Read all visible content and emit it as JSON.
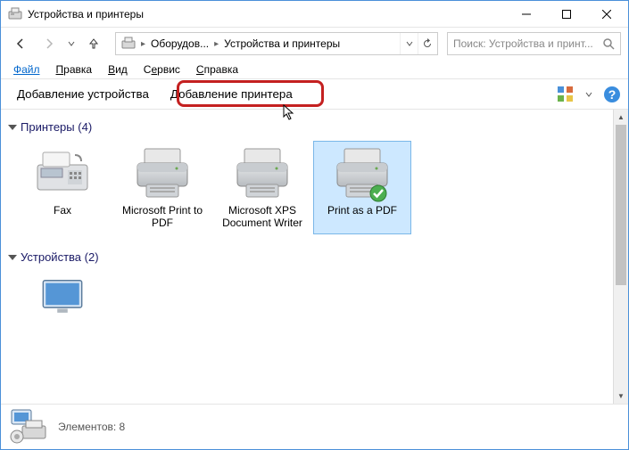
{
  "window": {
    "title": "Устройства и принтеры"
  },
  "breadcrumb": {
    "seg1": "Оборудов...",
    "seg2": "Устройства и принтеры"
  },
  "search": {
    "placeholder": "Поиск: Устройства и принт..."
  },
  "menu": {
    "file": "Файл",
    "edit": "Правка",
    "view": "Вид",
    "tools": "Сервис",
    "help": "Справка"
  },
  "commands": {
    "add_device": "Добавление устройства",
    "add_printer": "Добавление принтера"
  },
  "groups": {
    "printers": {
      "label": "Принтеры",
      "count": "(4)"
    },
    "devices": {
      "label": "Устройства",
      "count": "(2)"
    }
  },
  "printers": [
    {
      "label": "Fax",
      "icon": "fax"
    },
    {
      "label": "Microsoft Print to PDF",
      "icon": "printer"
    },
    {
      "label": "Microsoft XPS Document Writer",
      "icon": "printer"
    },
    {
      "label": "Print as a PDF",
      "icon": "printer",
      "default": true,
      "selected": true
    }
  ],
  "status": {
    "label": "Элементов:",
    "value": "8"
  }
}
